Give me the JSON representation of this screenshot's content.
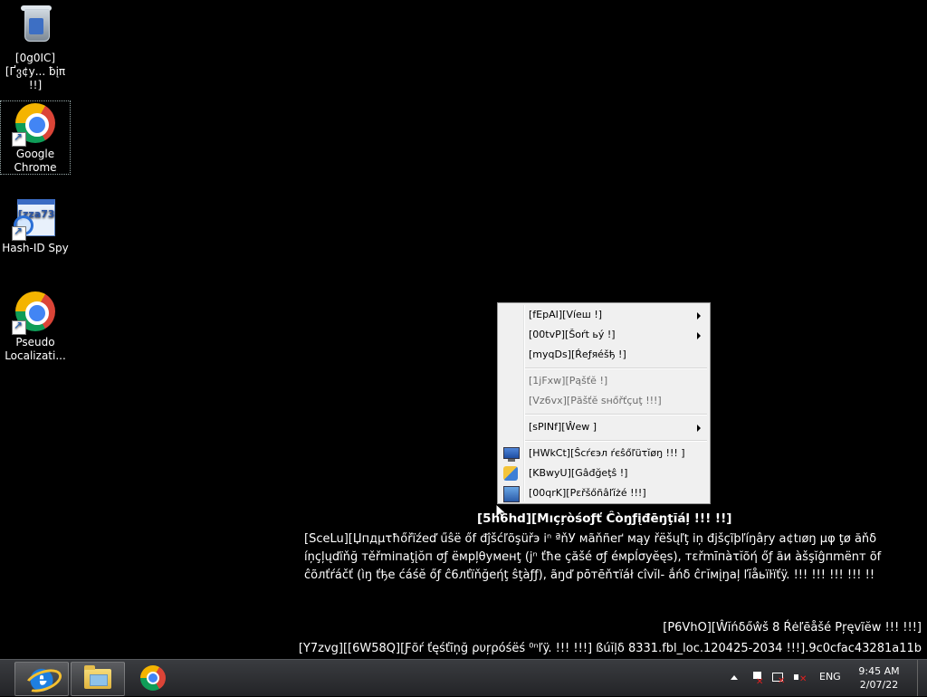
{
  "desktop": {
    "icons": [
      {
        "label": "[0g0IC][Ґვ¢у... ƀįπ !!]",
        "icon": "recycle-bin-icon"
      },
      {
        "label": "Google Chrome",
        "icon": "chrome-icon"
      },
      {
        "label": "Hash-ID Spy",
        "icon": "hash-id-spy-icon",
        "glyph": "[zza73"
      },
      {
        "label": "Pseudo Localizati...",
        "icon": "chrome-icon"
      }
    ]
  },
  "context_menu": {
    "items": [
      {
        "label": "[fEpAI][Víеш !]",
        "has_submenu": true,
        "disabled": false
      },
      {
        "label": "[00tvP][Šoŕt ьý !]",
        "has_submenu": true,
        "disabled": false
      },
      {
        "label": "[myqDs][Ŕеƒяéšђ !]",
        "has_submenu": false,
        "disabled": false
      },
      {
        "label": "[1jFxw][Рąšťĕ !]",
        "has_submenu": false,
        "disabled": true
      },
      {
        "label": "[Vz6vx][Рăšťĕ ѕнőřťçuţ !!!]",
        "has_submenu": false,
        "disabled": true
      },
      {
        "label": "[sPINf][Ŵеw ]",
        "has_submenu": true,
        "disabled": false
      },
      {
        "label": "[HWkCt][Ŝсŕєэл ŕєŝőľüτĭøŋ !!! ]",
        "has_submenu": false,
        "disabled": false,
        "icon": "screen-resolution-icon"
      },
      {
        "label": "[KBwyU][Gâđğeţŝ !]",
        "has_submenu": false,
        "disabled": false,
        "icon": "gadgets-icon"
      },
      {
        "label": "[00qrK][Pεřšőñâľĭżé !!!]",
        "has_submenu": false,
        "disabled": false,
        "icon": "personalize-icon"
      }
    ]
  },
  "watermark": {
    "title": "[5h6hd][Мıçŗòśоƒť Ĉòŋƒįđēŋţĩáļ !!! !!]",
    "body": "[SceLu][Џпдμτħőřïźеď űŝё őf đĵšćľõşüřэ іⁿ ªňУ мãňñеґ мąу řёšųľţ iņ đјšçĩþľíŋâŗy a¢tıøŋ μφ ţø ăňδ íņçļųďïňğ тěřmіпаţįŏп σƒ ёмрļθуменţ (јⁿ ťħe çăšé σƒ éмрĺσуĕęѕ), тεřmīпàτĭõή őƒ ãи àšşĭĝпmёnт õf ĉõлťŕáčť (ìŋ ťђе ćáśĕ őƒ ĉ6лťїňğеήţ ŝţàƒƒ), ãŋď рōтēňτїáł cîvĭl- ắńδ ĉгĭмįŋаļ ľĭåьïŀïťÿ. !!! !!! !!! !!! !!",
    "edition": "[P6VhO][Ŵĭńδőŵš 8 Ŕėľēåšé Pŗęvĩĕw !!! !!!]",
    "build": "[Y7zvg][[6W58Q][Ƒõŕ ťęśťīņğ ρυŗρóśёś ⁰ⁿľÿ. !!! !!!] ßúĭļδ 8331.fbl_loc.120425-2034 !!!].9c0cfac43281a11b"
  },
  "taskbar": {
    "pinned": [
      {
        "name": "internet-explorer",
        "icon": "ie-icon"
      },
      {
        "name": "file-explorer",
        "icon": "folder-icon"
      },
      {
        "name": "google-chrome",
        "icon": "chrome-icon"
      }
    ],
    "tray": {
      "show_hidden": "show-hidden-icons",
      "icons": [
        "action-center-flag-icon",
        "network-icon",
        "volume-muted-icon"
      ],
      "language": "ENG",
      "time": "9:45 AM",
      "date": "2/07/22"
    }
  }
}
